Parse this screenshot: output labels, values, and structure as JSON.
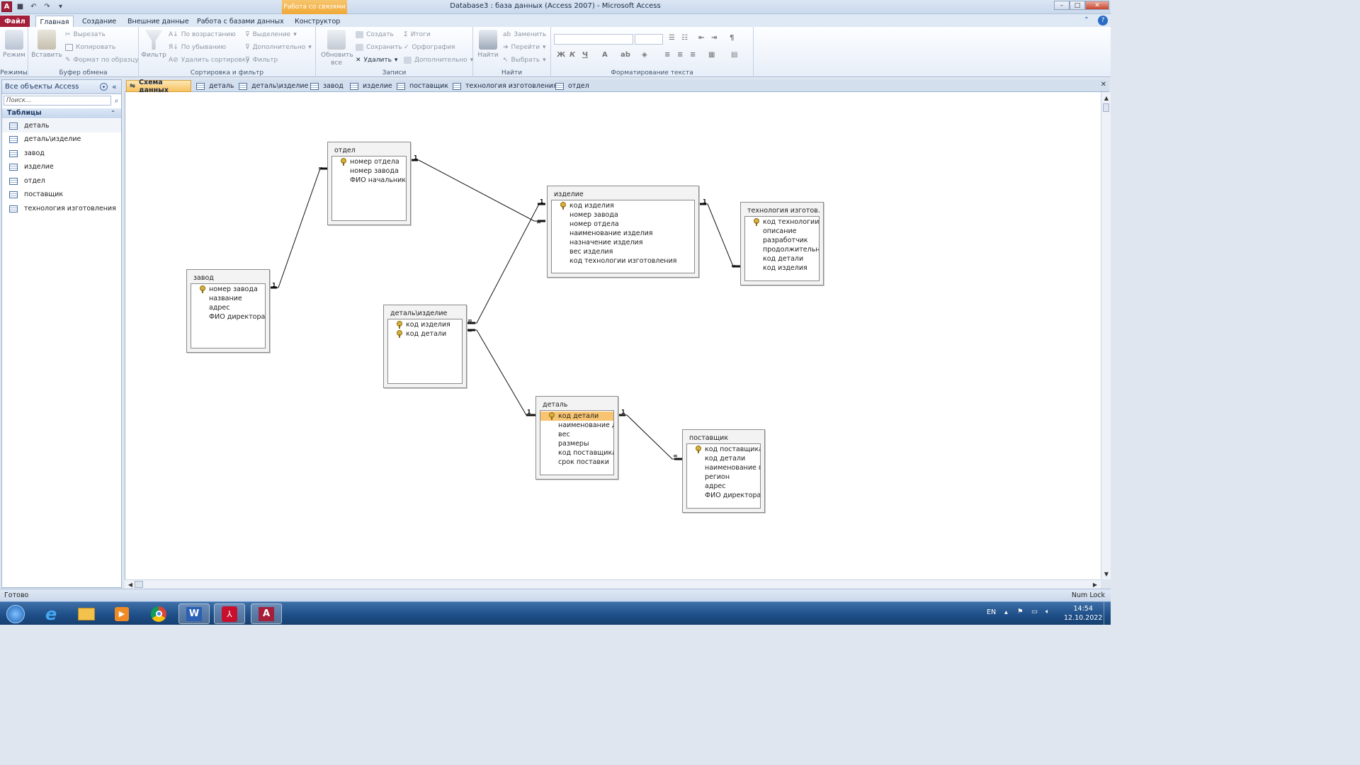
{
  "titlebar": {
    "title": "Database3 : база данных (Access 2007)  -  Microsoft Access",
    "context_tab": "Работа со связями"
  },
  "ribbon_tabs": [
    "Файл",
    "Главная",
    "Создание",
    "Внешние данные",
    "Работа с базами данных",
    "Конструктор"
  ],
  "ribbon": {
    "views": {
      "mode": "Режим",
      "label": "Режимы"
    },
    "clipboard": {
      "paste": "Вставить",
      "cut": "Вырезать",
      "copy": "Копировать",
      "format_painter": "Формат по образцу",
      "label": "Буфер обмена"
    },
    "sort_filter": {
      "filter": "Фильтр",
      "asc": "По возрастанию",
      "desc": "По убыванию",
      "remove_sort": "Удалить сортировку",
      "selection": "Выделение",
      "advanced": "Дополнительно",
      "toggle_filter": "Фильтр",
      "label": "Сортировка и фильтр"
    },
    "records": {
      "refresh": "Обновить все",
      "new": "Создать",
      "save": "Сохранить",
      "delete": "Удалить",
      "totals": "Итоги",
      "spelling": "Орфография",
      "more": "Дополнительно",
      "label": "Записи"
    },
    "find": {
      "find": "Найти",
      "replace": "Заменить",
      "goto": "Перейти",
      "select": "Выбрать",
      "label": "Найти"
    },
    "text_format": {
      "bold": "Ж",
      "italic": "К",
      "underline": "Ч",
      "label": "Форматирование текста"
    }
  },
  "nav_pane": {
    "title": "Все объекты Access",
    "search_placeholder": "Поиск...",
    "section": "Таблицы",
    "items": [
      "деталь",
      "деталь\\изделие",
      "завод",
      "изделие",
      "отдел",
      "поставщик",
      "технология изготовления"
    ]
  },
  "doc_tabs": [
    "Схема данных",
    "деталь",
    "деталь\\изделие",
    "завод",
    "изделие",
    "поставщик",
    "технология изготовления",
    "отдел"
  ],
  "diagram": {
    "tables": {
      "otdel": {
        "title": "отдел",
        "fields": [
          "номер отдела",
          "номер завода",
          "ФИО начальника"
        ]
      },
      "zavod": {
        "title": "завод",
        "fields": [
          "номер завода",
          "название",
          "адрес",
          "ФИО директора"
        ]
      },
      "izdelie": {
        "title": "изделие",
        "fields": [
          "код изделия",
          "номер завода",
          "номер отдела",
          "наименование изделия",
          "назначение изделия",
          "вес изделия",
          "код технологии изготовления"
        ]
      },
      "tech": {
        "title": "технология изготов...",
        "fields": [
          "код технологии",
          "описание",
          "разработчик",
          "продолжительность",
          "код детали",
          "код изделия"
        ]
      },
      "det_izd": {
        "title": "деталь\\изделие",
        "fields": [
          "код изделия",
          "код детали"
        ]
      },
      "detal": {
        "title": "деталь",
        "fields": [
          "код детали",
          "наименование детали",
          "вес",
          "размеры",
          "код поставщика",
          "срок поставки"
        ]
      },
      "postav": {
        "title": "поставщик",
        "fields": [
          "код поставщика",
          "код детали",
          "наименование поставщика",
          "регион",
          "адрес",
          "ФИО директора"
        ]
      }
    },
    "one": "1",
    "many": "∞"
  },
  "status": {
    "left": "Готово",
    "right": "Num Lock"
  },
  "taskbar": {
    "lang": "EN",
    "time": "14:54",
    "date": "12.10.2022"
  }
}
